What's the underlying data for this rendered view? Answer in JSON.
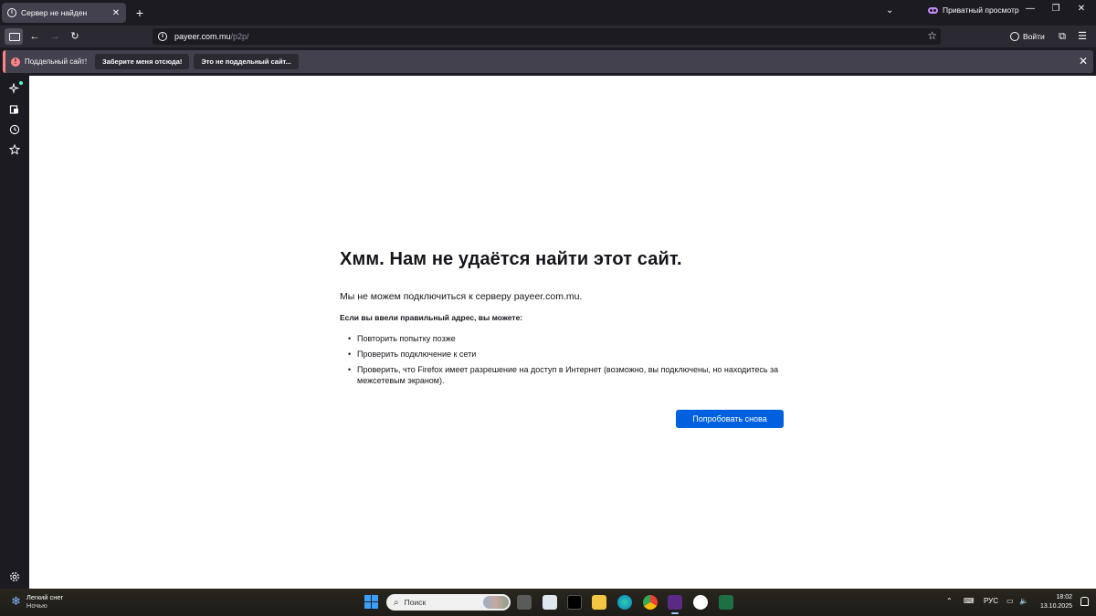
{
  "browser": {
    "tab": {
      "title": "Сервер не найден",
      "close": "✕"
    },
    "new_tab": "+",
    "tabs_dropdown": "⌄",
    "private_label": "Приватный просмотр",
    "window_controls": {
      "minimize": "—",
      "restore": "❐",
      "close": "✕"
    },
    "nav": {
      "back": "←",
      "forward": "→",
      "reload": "↻"
    },
    "url": {
      "host": "payeer.com.mu",
      "path": "/p2p/"
    },
    "bookmark_star": "☆",
    "signin_label": "Войти",
    "extensions_icon": "⧉",
    "menu_icon": "☰"
  },
  "notification": {
    "icon": "!",
    "message": "Поддельный сайт!",
    "button_leave": "Заберите меня отсюда!",
    "button_not_deceptive": "Это не поддельный сайт...",
    "close": "✕"
  },
  "sidebar": {
    "icons": [
      "sparkle-icon",
      "synced-tabs-icon",
      "history-icon",
      "bookmarks-icon",
      "settings-icon"
    ]
  },
  "error_page": {
    "title": "Хмм. Нам не удаётся найти этот сайт.",
    "lead": "Мы не можем подключиться к серверу payeer.com.mu.",
    "subheading": "Если вы ввели правильный адрес, вы можете:",
    "suggestions": [
      "Повторить попытку позже",
      "Проверить подключение к сети",
      "Проверить, что Firefox имеет разрешение на доступ в Интернет (возможно, вы подключены, но находитесь за межсетевым экраном)."
    ],
    "retry_button": "Попробовать снова"
  },
  "taskbar": {
    "weather": {
      "condition": "Легкий снег",
      "period": "Ночью"
    },
    "search_placeholder": "Поиск",
    "language": "РУС",
    "time": "18:02",
    "date": "13.10.2025"
  },
  "colors": {
    "accent_button": "#0061e0",
    "warning": "#ff848b",
    "private_purple": "#c58af9"
  }
}
